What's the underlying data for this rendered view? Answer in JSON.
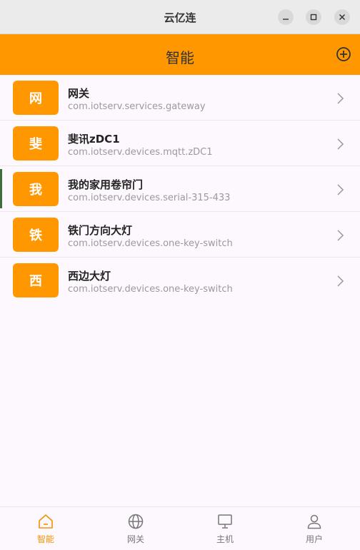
{
  "window": {
    "title": "云亿连"
  },
  "header": {
    "title": "智能",
    "add_icon": "plus-circle-icon"
  },
  "devices": [
    {
      "badge": "网",
      "name": "网关",
      "id": "com.iotserv.services.gateway"
    },
    {
      "badge": "斐",
      "name": "斐讯zDC1",
      "id": "com.iotserv.devices.mqtt.zDC1"
    },
    {
      "badge": "我",
      "name": "我的家用卷帘门",
      "id": "com.iotserv.devices.serial-315-433"
    },
    {
      "badge": "铁",
      "name": "铁门方向大灯",
      "id": "com.iotserv.devices.one-key-switch"
    },
    {
      "badge": "西",
      "name": "西边大灯",
      "id": "com.iotserv.devices.one-key-switch"
    }
  ],
  "nav": [
    {
      "label": "智能",
      "icon": "home-icon",
      "active": true
    },
    {
      "label": "网关",
      "icon": "globe-icon",
      "active": false
    },
    {
      "label": "主机",
      "icon": "monitor-icon",
      "active": false
    },
    {
      "label": "用户",
      "icon": "user-icon",
      "active": false
    }
  ],
  "colors": {
    "accent": "#ff9800",
    "active_nav": "#f39200"
  }
}
